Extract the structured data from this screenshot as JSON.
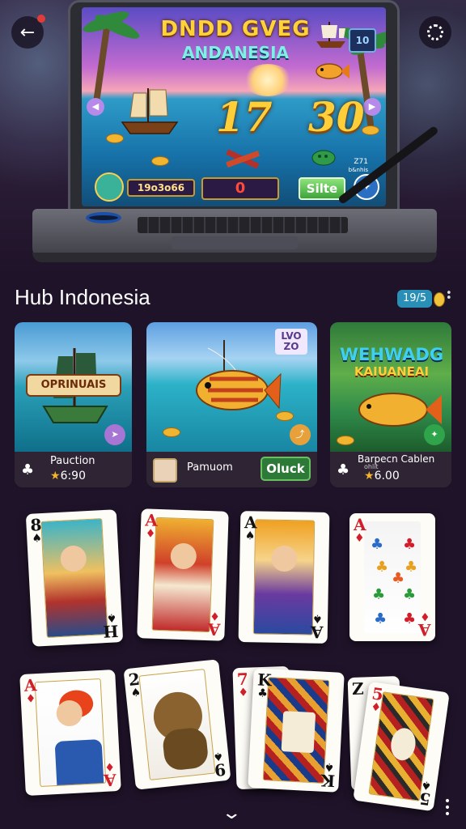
{
  "hero": {
    "title": "DNDD GVEG",
    "subtitle": "ANDANESIA",
    "level_badge": "10",
    "score_left": "17",
    "score_right": "30",
    "player_id": "19o3o66",
    "counter_value": "0",
    "spin_label": "Silte",
    "screen_caption": "Z71",
    "screen_caption_small": "b&nhis"
  },
  "section": {
    "title": "Hub Indonesia",
    "counter": "19/5"
  },
  "tiles": [
    {
      "banner": "OPRINUAIS",
      "name": "Pauction",
      "rating": "6:90",
      "badge": ""
    },
    {
      "badge_top": "LVO",
      "badge_bottom": "ZO",
      "name": "Pamuom",
      "action": "Oluck"
    },
    {
      "banner_a": "WEHWADG",
      "banner_b": "KAIUANEAI",
      "name": "Barpecn Cablen",
      "sub": "ohlit",
      "rating": "6.00"
    }
  ],
  "cards": [
    {
      "rank": "8",
      "suit": "♠",
      "color": "black",
      "rank_br": "H",
      "suit_br": "♠"
    },
    {
      "rank": "A",
      "suit": "♦",
      "color": "red",
      "rank_br": "A",
      "suit_br": "♦"
    },
    {
      "rank": "A",
      "suit": "♠",
      "color": "black",
      "rank_br": "A",
      "suit_br": "♠"
    },
    {
      "rank": "A",
      "suit": "♦",
      "color": "red",
      "rank_br": "A",
      "suit_br": "♦"
    },
    {
      "rank": "A",
      "suit": "♦",
      "color": "red",
      "rank_br": "A",
      "suit_br": "♦"
    },
    {
      "rank": "2",
      "suit": "♠",
      "color": "black",
      "rank_br": "9",
      "suit_br": "♠"
    },
    {
      "rank": "K",
      "suit": "♣",
      "color": "black",
      "rank_br": "K",
      "suit_br": "♠"
    },
    {
      "rank": "7",
      "suit": "♦",
      "color": "red",
      "rank_br": "",
      "suit_br": ""
    },
    {
      "rank": "5",
      "suit": "♦",
      "color": "red",
      "rank_br": "5",
      "suit_br": "♠"
    },
    {
      "rank": "Z",
      "suit": "",
      "color": "black",
      "rank_br": "",
      "suit_br": ""
    }
  ],
  "icons": {
    "back": "back-arrow-icon",
    "loading": "loading-icon",
    "expand": "chevron-down-icon",
    "more": "more-vertical-icon"
  },
  "colors": {
    "background": "#1f1329",
    "accent_gold": "#ffcf3a",
    "pill_blue": "#2a8fb7",
    "join_green": "#2d7a38"
  }
}
